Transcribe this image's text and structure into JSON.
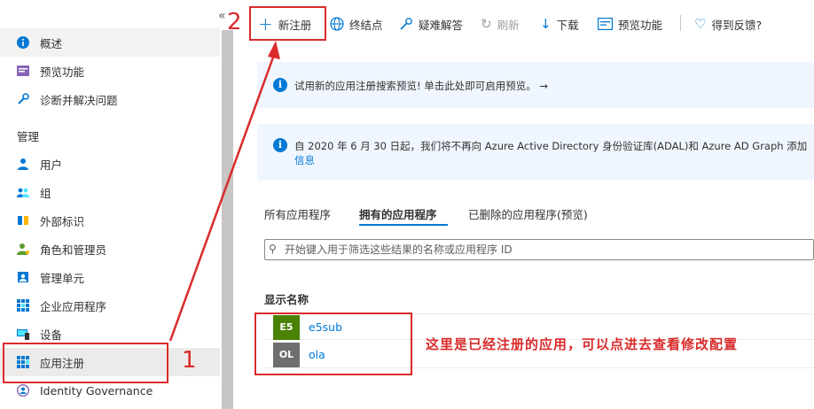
{
  "sidebar": {
    "collapse_glyph": "«",
    "items": [
      {
        "label": "概述",
        "icon": "info-icon"
      },
      {
        "label": "预览功能",
        "icon": "preview-icon"
      },
      {
        "label": "诊断并解决问题",
        "icon": "wrench-icon"
      }
    ],
    "section_manage": "管理",
    "manage_items": [
      {
        "label": "用户",
        "icon": "user-icon"
      },
      {
        "label": "组",
        "icon": "group-icon"
      },
      {
        "label": "外部标识",
        "icon": "external-id-icon"
      },
      {
        "label": "角色和管理员",
        "icon": "roles-icon"
      },
      {
        "label": "管理单元",
        "icon": "admin-unit-icon"
      },
      {
        "label": "企业应用程序",
        "icon": "enterprise-apps-icon"
      },
      {
        "label": "设备",
        "icon": "device-icon"
      },
      {
        "label": "应用注册",
        "icon": "app-registration-icon",
        "active": true
      },
      {
        "label": "Identity Governance",
        "icon": "identity-governance-icon"
      }
    ]
  },
  "toolbar": {
    "new_registration": "新注册",
    "endpoints": "终结点",
    "troubleshoot": "疑难解答",
    "refresh": "刷新",
    "download": "下载",
    "preview_features": "预览功能",
    "feedback": "得到反馈?"
  },
  "banners": {
    "preview_search": "试用新的应用注册搜索预览! 单击此处即可启用预览。 →",
    "adal_notice": "自 2020 年 6 月 30 日起，我们将不再向 Azure Active Directory 身份验证库(ADAL)和 Azure AD Graph 添加",
    "adal_notice_link": "信息"
  },
  "tabs": {
    "all": "所有应用程序",
    "owned": "拥有的应用程序",
    "deleted": "已删除的应用程序(预览)"
  },
  "filter": {
    "placeholder": "开始键入用于筛选这些结果的名称或应用程序 ID"
  },
  "table": {
    "column_display_name": "显示名称",
    "rows": [
      {
        "initials": "E5",
        "name": "e5sub",
        "tile_color": "#498205"
      },
      {
        "initials": "OL",
        "name": "ola",
        "tile_color": "#6e6e6e"
      }
    ]
  },
  "annotations": {
    "step1": "1",
    "step2": "2",
    "note": "这里是已经注册的应用，可以点进去查看修改配置",
    "color": "#d92b2b"
  }
}
